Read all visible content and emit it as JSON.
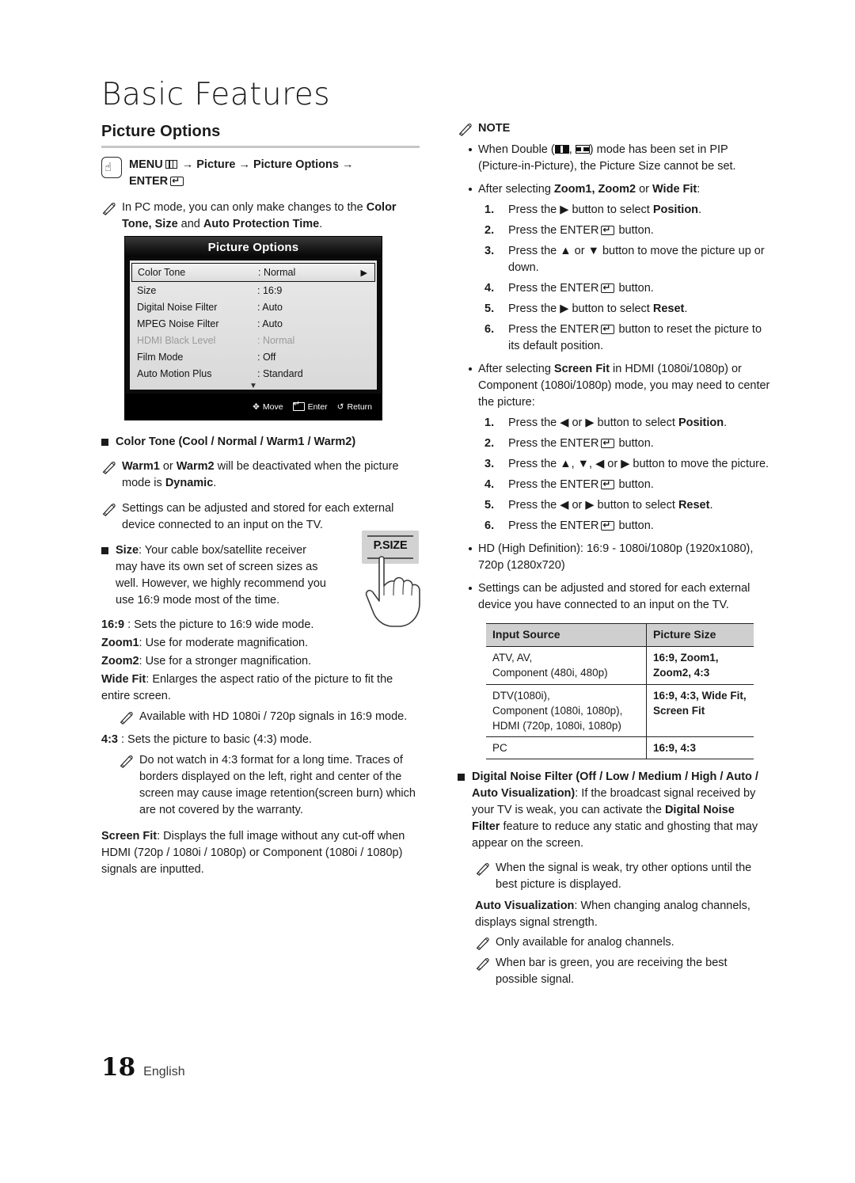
{
  "page": {
    "chapter_title": "Basic Features",
    "footer_page_number": "18",
    "footer_language": "English"
  },
  "left": {
    "section_title": "Picture Options",
    "menu_path": {
      "prefix": "MENU",
      "menu_icon": "menu-grid-icon",
      "arrow1": " → Picture → Picture Options →",
      "enter_label": "ENTER",
      "enter_icon": "enter-icon"
    },
    "pc_mode_note": {
      "t1": "In PC mode, you can only make changes to the ",
      "b1": "Color Tone, Size",
      "t2": " and ",
      "b2": "Auto Protection Time",
      "t3": "."
    },
    "tv_menu": {
      "title": "Picture Options",
      "rows": [
        {
          "label": "Color Tone",
          "value": ": Normal",
          "selected": true,
          "dim": false,
          "arrow": "▶"
        },
        {
          "label": "Size",
          "value": ": 16:9",
          "selected": false,
          "dim": false,
          "arrow": ""
        },
        {
          "label": "Digital Noise Filter",
          "value": ": Auto",
          "selected": false,
          "dim": false,
          "arrow": ""
        },
        {
          "label": "MPEG Noise Filter",
          "value": ": Auto",
          "selected": false,
          "dim": false,
          "arrow": ""
        },
        {
          "label": "HDMI Black Level",
          "value": ": Normal",
          "selected": false,
          "dim": true,
          "arrow": ""
        },
        {
          "label": "Film Mode",
          "value": ": Off",
          "selected": false,
          "dim": false,
          "arrow": ""
        },
        {
          "label": "Auto Motion Plus",
          "value": ": Standard",
          "selected": false,
          "dim": false,
          "arrow": ""
        }
      ],
      "scroll_down_glyph": "▼",
      "footer": {
        "move_glyph": "✥",
        "move_label": "Move",
        "enter_label": "Enter",
        "return_glyph": "↺",
        "return_label": "Return"
      }
    },
    "color_tone_heading": "Color Tone (Cool / Normal / Warm1 / Warm2)",
    "warm_note": {
      "b1": "Warm1",
      "t1": " or ",
      "b2": "Warm2",
      "t2": " will be deactivated when the picture mode is ",
      "b3": "Dynamic",
      "t3": "."
    },
    "stored_note": "Settings can be adjusted and stored for each external device connected to an input on the TV.",
    "size_item": {
      "bold": "Size",
      "text": ": Your cable box/satellite receiver may have its own set of screen sizes as well. However, we highly recommend you use 16:9 mode most of the time."
    },
    "psize_button_label": "P.SIZE",
    "size_modes": [
      {
        "name": "16:9 ",
        "desc": ": Sets the picture to 16:9 wide mode."
      },
      {
        "name": "Zoom1",
        "desc": ": Use for moderate magnification."
      },
      {
        "name": "Zoom2",
        "desc": ": Use for a stronger magnification."
      },
      {
        "name": "Wide Fit",
        "desc": ": Enlarges the aspect ratio of the picture to fit the entire screen."
      }
    ],
    "wide_fit_note": "Available with HD 1080i / 720p signals in 16:9 mode.",
    "mode_43": {
      "name": "4:3 ",
      "desc": ": Sets the picture to basic (4:3) mode."
    },
    "note_43": "Do not watch in 4:3 format for a long time. Traces of borders displayed on the left, right and center of the screen may cause image retention(screen burn) which are not covered by the warranty.",
    "screen_fit": {
      "bold": "Screen Fit",
      "text": ": Displays the full image without any cut-off when HDMI (720p / 1080i / 1080p) or Component (1080i / 1080p) signals are inputted."
    }
  },
  "right": {
    "note_heading": "NOTE",
    "bullet_double": {
      "t1": "When Double (",
      "icon1": "pip-double-wide-icon",
      "t2": ", ",
      "icon2": "pip-double-small-icon",
      "t3": ") mode has been set in PIP (Picture-in-Picture), the Picture Size cannot be set."
    },
    "bullet_zoom": {
      "t1": "After selecting ",
      "b1": "Zoom1, Zoom2",
      "t2": " or ",
      "b2": "Wide Fit",
      "t3": ":"
    },
    "zoom_steps": [
      {
        "num": "1.",
        "pre": "Press the ▶ button to select ",
        "bold": "Position",
        "post": "."
      },
      {
        "num": "2.",
        "pre": "Press the ENTER",
        "enter_icon": true,
        "post": " button."
      },
      {
        "num": "3.",
        "pre": "Press the ▲ or ▼ button to move the picture up or down.",
        "bold": "",
        "post": ""
      },
      {
        "num": "4.",
        "pre": "Press the ENTER",
        "enter_icon": true,
        "post": " button."
      },
      {
        "num": "5.",
        "pre": "Press the ▶ button to select ",
        "bold": "Reset",
        "post": "."
      },
      {
        "num": "6.",
        "pre": "Press the ENTER",
        "enter_icon": true,
        "post": " button to reset the picture to its default position."
      }
    ],
    "bullet_screenfit": {
      "t1": "After selecting ",
      "b1": "Screen Fit",
      "t2": " in HDMI (1080i/1080p) or Component (1080i/1080p) mode, you may need to center the picture:"
    },
    "screenfit_steps": [
      {
        "num": "1.",
        "pre": "Press the ◀ or ▶ button to select ",
        "bold": "Position",
        "post": "."
      },
      {
        "num": "2.",
        "pre": "Press the ENTER",
        "enter_icon": true,
        "post": " button."
      },
      {
        "num": "3.",
        "pre": "Press the ▲, ▼, ◀ or ▶ button to move the picture.",
        "bold": "",
        "post": ""
      },
      {
        "num": "4.",
        "pre": "Press the ENTER",
        "enter_icon": true,
        "post": " button."
      },
      {
        "num": "5.",
        "pre": "Press the ◀ or ▶ button to select ",
        "bold": "Reset",
        "post": "."
      },
      {
        "num": "6.",
        "pre": "Press the ENTER",
        "enter_icon": true,
        "post": " button."
      }
    ],
    "bullet_hd": "HD (High Definition): 16:9 - 1080i/1080p (1920x1080), 720p (1280x720)",
    "bullet_settings": "Settings can be adjusted and stored for each external device you have connected to an input on the TV.",
    "table": {
      "headers": [
        "Input Source",
        "Picture Size"
      ],
      "rows": [
        {
          "source": "ATV, AV,\nComponent (480i, 480p)",
          "size": "16:9, Zoom1,\nZoom2, 4:3"
        },
        {
          "source": "DTV(1080i),\nComponent (1080i, 1080p),\nHDMI (720p, 1080i, 1080p)",
          "size": "16:9, 4:3, Wide Fit,\nScreen Fit"
        },
        {
          "source": "PC",
          "size": "16:9, 4:3"
        }
      ]
    },
    "dnf_item": {
      "b1": "Digital Noise Filter (Off / Low / Medium / High / Auto / Auto Visualization)",
      "t1": ": If the broadcast signal received by your TV is weak, you can activate the ",
      "b2": "Digital Noise Filter",
      "t2": " feature to reduce any static and ghosting that may appear on the screen."
    },
    "dnf_note": "When the signal is weak, try other options until the best picture is displayed.",
    "auto_vis": {
      "bold": "Auto Visualization",
      "text": ": When changing analog channels, displays signal strength."
    },
    "auto_vis_notes": [
      "Only available for analog channels.",
      "When bar is green, you are receiving the best possible signal."
    ]
  }
}
